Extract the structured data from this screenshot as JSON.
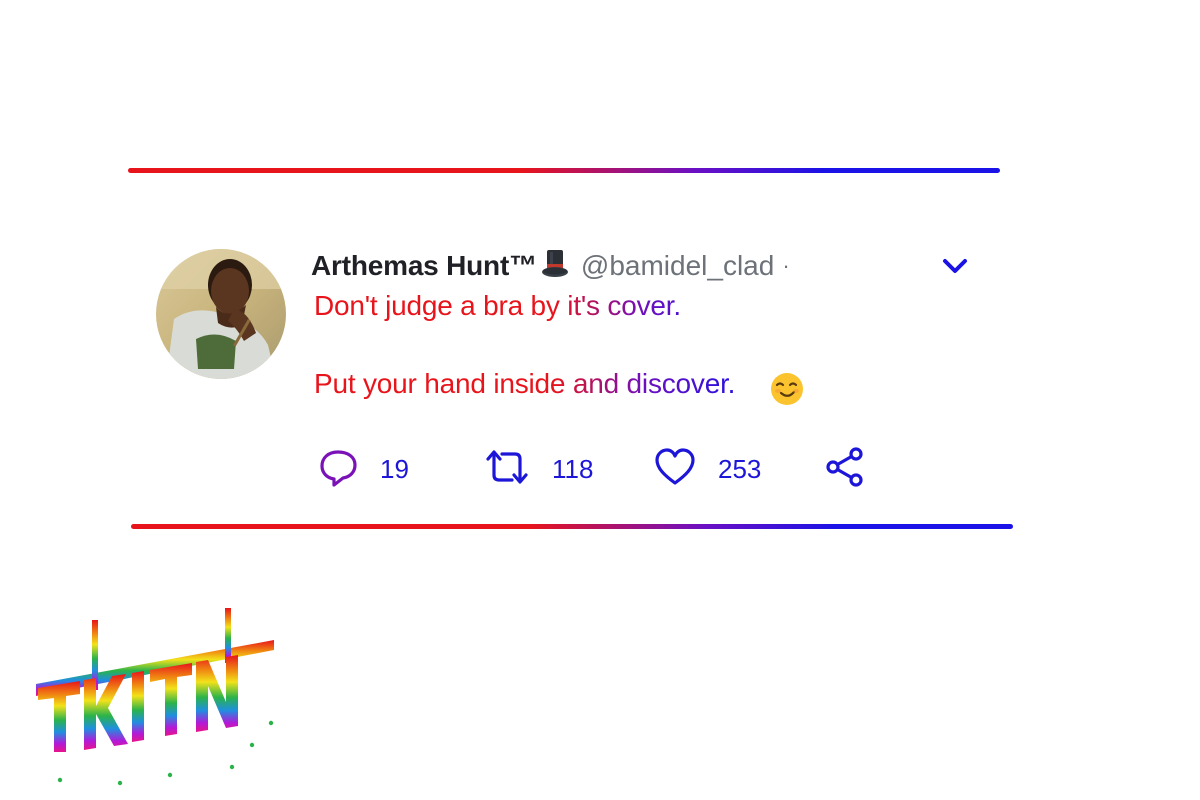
{
  "tweet": {
    "display_name": "Arthemas Hunt™",
    "handle": "@bamidel_clad",
    "separator": "·",
    "line1": "Don't judge a bra by it's cover.",
    "line2": "Put your hand inside and discover."
  },
  "icons": {
    "badge": "top-hat-icon",
    "menu": "chevron-down-icon",
    "emoji": "smiling-face-icon",
    "reply": "reply-icon",
    "retweet": "retweet-icon",
    "like": "heart-icon",
    "share": "share-icon"
  },
  "stats": {
    "replies": "19",
    "retweets": "118",
    "likes": "253"
  },
  "watermark": {
    "text": "TKITN"
  },
  "colors": {
    "red": "#e8141b",
    "blue": "#1a12e6",
    "name": "#202126",
    "handle": "#6d7279"
  }
}
